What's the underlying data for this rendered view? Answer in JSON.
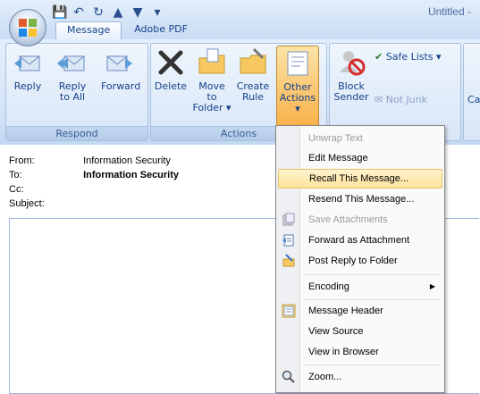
{
  "window": {
    "title": "Untitled -"
  },
  "tabs": [
    {
      "label": "Message"
    },
    {
      "label": "Adobe PDF"
    }
  ],
  "ribbon": {
    "respond": {
      "label": "Respond",
      "reply": "Reply",
      "reply_all_1": "Reply",
      "reply_all_2": "to All",
      "forward": "Forward"
    },
    "actions": {
      "label": "Actions",
      "delete": "Delete",
      "move_1": "Move to",
      "move_2": "Folder ▾",
      "create_1": "Create",
      "create_2": "Rule",
      "other_1": "Other",
      "other_2": "Actions ▾"
    },
    "junk": {
      "block_1": "Block",
      "block_2": "Sender",
      "safe_lists": "Safe Lists ▾",
      "not_junk": "Not Junk",
      "cat": "Cat"
    }
  },
  "headers": {
    "from_label": "From:",
    "from_value": "Information Security",
    "to_label": "To:",
    "to_value": "Information Security",
    "cc_label": "Cc:",
    "subject_label": "Subject:"
  },
  "menu": {
    "unwrap": "Unwrap Text",
    "edit": "Edit Message",
    "recall": "Recall This Message...",
    "resend": "Resend This Message...",
    "save_att": "Save Attachments",
    "fwd_att": "Forward as Attachment",
    "post_reply": "Post Reply to Folder",
    "encoding": "Encoding",
    "msg_header": "Message Header",
    "view_source": "View Source",
    "view_browser": "View in Browser",
    "zoom": "Zoom..."
  },
  "colors": {
    "accent": "#15428b",
    "highlight": "#fde39a",
    "pressed": "#f8b048"
  }
}
